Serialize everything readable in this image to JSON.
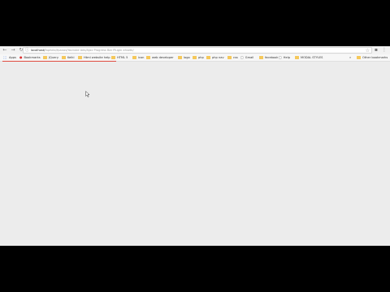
{
  "address": {
    "host": "localhost/",
    "path": "fapfolio/fpanos/Youtube Ads/Ajax Progress Bar Plugin ahsetk/",
    "page_icon": "info-icon"
  },
  "toolbar_icons": [
    "back-arrow-icon",
    "forward-arrow-icon",
    "reload-icon",
    "star-icon",
    "extension-icon",
    "menu-icon"
  ],
  "bookmarks": [
    {
      "label": "Apps",
      "icon": "apps-icon"
    },
    {
      "label": "Bookmarks",
      "icon": "bookmark-icon"
    },
    {
      "label": "JQuery",
      "icon": "folder-icon"
    },
    {
      "label": "Kelkl",
      "icon": "folder-icon"
    },
    {
      "label": "Html website help",
      "icon": "folder-icon"
    },
    {
      "label": "HTML 5",
      "icon": "folder-icon"
    },
    {
      "label": "icon",
      "icon": "folder-icon"
    },
    {
      "label": "web developer",
      "icon": "folder-icon"
    },
    {
      "label": "logo",
      "icon": "folder-icon"
    },
    {
      "label": "php",
      "icon": "folder-icon"
    },
    {
      "label": "php nav",
      "icon": "folder-icon"
    },
    {
      "label": "css",
      "icon": "folder-icon"
    },
    {
      "label": "Gmail",
      "icon": "page-icon"
    },
    {
      "label": "facebook",
      "icon": "folder-icon"
    },
    {
      "label": "Help",
      "icon": "page-icon"
    },
    {
      "label": "MODAL STYLES",
      "icon": "folder-icon"
    },
    {
      "label": "Other bookmarks",
      "icon": "folder-icon"
    }
  ],
  "more_bookmarks": "»",
  "colors": {
    "page_background": "#ececec",
    "loading_bar": "#e04a3f",
    "folder": "#f5c85b"
  }
}
